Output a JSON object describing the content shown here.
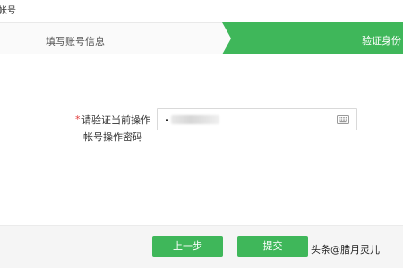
{
  "header": {
    "title": "帐号"
  },
  "steps": [
    {
      "label": "填写账号信息",
      "active": false
    },
    {
      "label": "验证身份",
      "active": true
    }
  ],
  "colors": {
    "accent": "#3fb75a",
    "required": "#e23b3b"
  },
  "form": {
    "required_mark": "*",
    "label_line1": "请验证当前操作",
    "label_line2": "帐号操作密码",
    "password_icon": "keyboard-icon"
  },
  "buttons": {
    "prev_label": "上一步",
    "submit_label": "提交"
  },
  "watermark": {
    "text": "头条@腊月灵儿"
  }
}
